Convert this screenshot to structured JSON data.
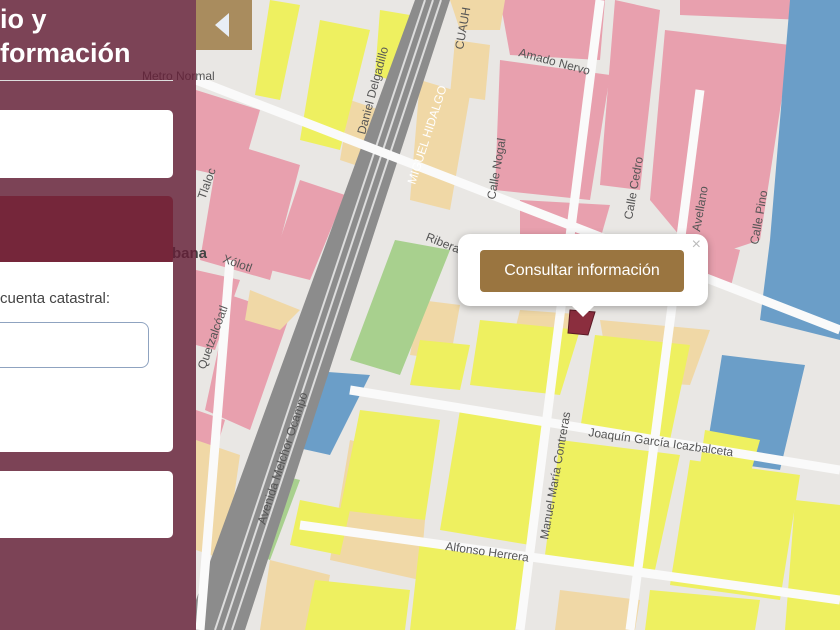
{
  "panel": {
    "title_line1": "io y",
    "title_line2": "formación",
    "field_label": "cuenta catastral:",
    "account_input_value": ""
  },
  "toggle": {
    "icon": "chevron-left-icon"
  },
  "popup": {
    "button_label": "Consultar información",
    "close_label": "×"
  },
  "map": {
    "labels": {
      "metro": "Metro Normal",
      "tlaloc": "Tlaloc",
      "xolotl": "Xólotl",
      "quetzalcoatl": "Quetzalcóatl",
      "colonia": "bana",
      "daniel": "Daniel Delgadillo",
      "miguel": "MIGUEL HIDALGO",
      "cuauh": "CUAUH",
      "amado": "Amado Nervo",
      "nogal": "Calle Nogal",
      "cedro": "Calle Cedro",
      "avellano": "Avellano",
      "pino": "Calle Pino",
      "ribera": "Ribera",
      "ocampo": "Avenida Melchor Ocampo",
      "contreras": "Manuel María Contreras",
      "icazbalceta": "Joaquín García Icazbalceta",
      "herrera": "Alfonso Herrera"
    },
    "colors": {
      "residential": "#e8a0ae",
      "mixed": "#eef060",
      "commercial": "#f0d8a6",
      "equipment": "#6b9ec8",
      "park": "#a8d08e",
      "selected": "#8b2e3e"
    }
  }
}
